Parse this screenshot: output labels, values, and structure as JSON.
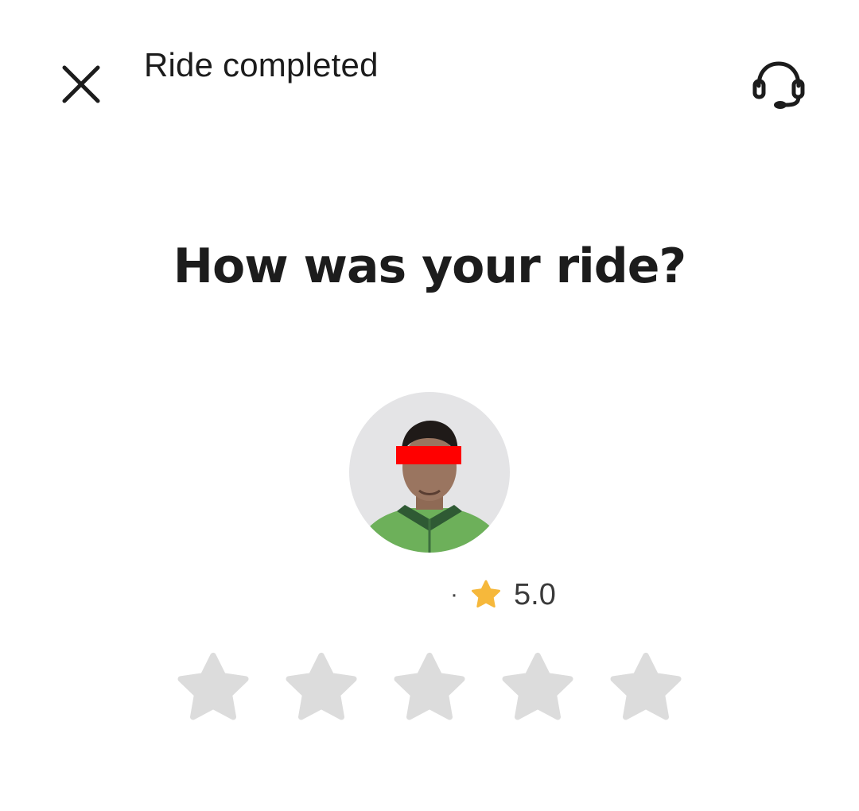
{
  "header": {
    "title": "Ride completed",
    "close_icon": "close-icon",
    "support_icon": "headset-icon"
  },
  "main": {
    "question": "How was your ride?",
    "driver": {
      "avatar_icon": "driver-photo",
      "rating_separator": "·",
      "rating_icon": "star-icon",
      "rating_value": "5.0"
    },
    "rating_input": {
      "max_stars": 5,
      "selected": 0,
      "empty_color": "#dcdcdc",
      "filled_color": "#f6b83b"
    }
  },
  "colors": {
    "text": "#1c1c1c",
    "background": "#ffffff",
    "star_badge": "#f6b83b"
  }
}
